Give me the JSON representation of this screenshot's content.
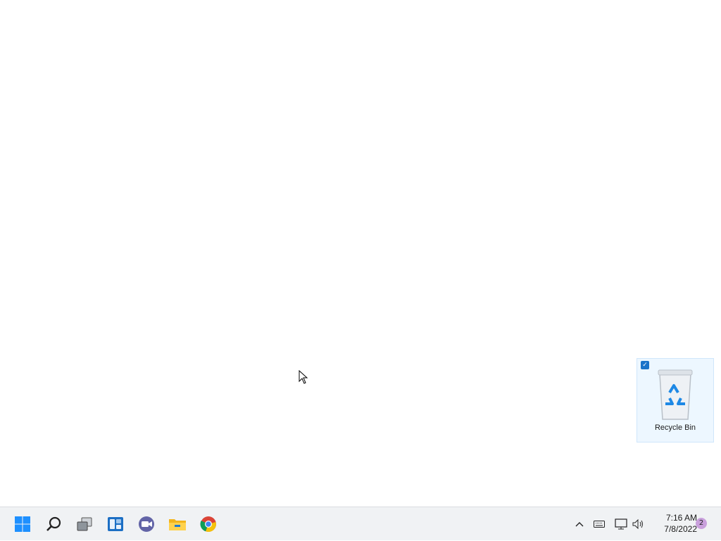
{
  "desktop": {
    "recycle_bin": {
      "label": "Recycle Bin",
      "icon": "recycle-bin-icon",
      "selected": true
    }
  },
  "taskbar": {
    "pinned": [
      {
        "name": "start-button",
        "icon": "windows-logo-icon"
      },
      {
        "name": "search-button",
        "icon": "search-icon"
      },
      {
        "name": "task-view-button",
        "icon": "task-view-icon"
      },
      {
        "name": "widgets-button",
        "icon": "widgets-icon"
      },
      {
        "name": "teams-chat-button",
        "icon": "teams-icon"
      },
      {
        "name": "file-explorer-button",
        "icon": "folder-icon"
      },
      {
        "name": "chrome-button",
        "icon": "chrome-icon"
      }
    ],
    "tray": {
      "icons": [
        "chevron-up-icon",
        "keyboard-icon",
        "network-icon",
        "volume-icon"
      ],
      "time": "7:16 AM",
      "date": "7/8/2022",
      "notification_count": "2"
    }
  },
  "colors": {
    "taskbar_bg": "#f0f2f4",
    "accent": "#0078d4"
  }
}
